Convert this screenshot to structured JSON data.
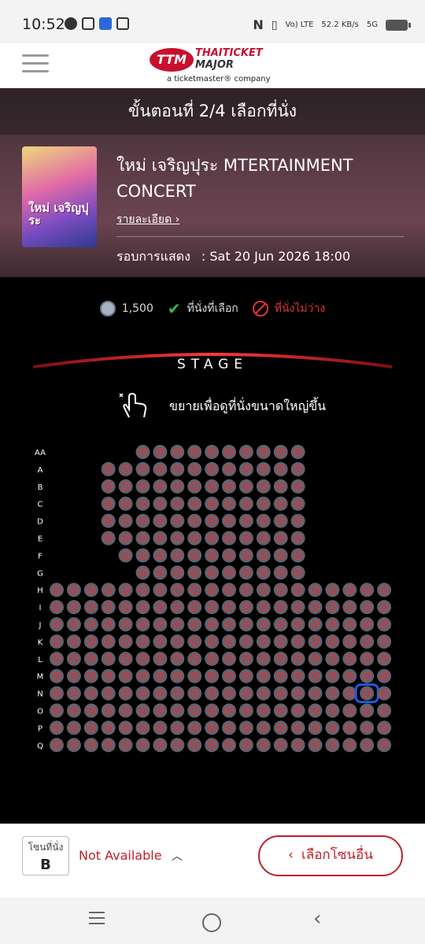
{
  "status_bar": {
    "time": "10:52",
    "network": "Vo) LTE",
    "speed": "52.2 KB/s",
    "signal": "5G"
  },
  "header": {
    "logo_badge": "TTM",
    "brand_line1": "THAITICKET",
    "brand_line2": "MAJOR",
    "tagline": "a ticketmaster® company"
  },
  "step": {
    "title": "ขั้นตอนที่ 2/4 เลือกที่นั่ง"
  },
  "event": {
    "poster_text": "ใหม่ เจริญปุระ",
    "title": "ใหม่ เจริญปุระ MTERTAINMENT CONCERT",
    "detail_link": "รายละเอียด ›",
    "showtime_label": "รอบการแสดง",
    "showtime_value": ": Sat 20 Jun 2026 18:00"
  },
  "legend": {
    "price": "1,500",
    "selected": "ที่นั่งที่เลือก",
    "unavailable": "ที่นั่งไม่ว่าง"
  },
  "stage": {
    "label": "STAGE"
  },
  "zoom_hint": "ขยายเพื่อดูที่นั่งขนาดใหญ่ขึ้น",
  "seatmap": {
    "rows": [
      "AA",
      "A",
      "B",
      "C",
      "D",
      "E",
      "F",
      "G",
      "H",
      "I",
      "J",
      "K",
      "L",
      "M",
      "N",
      "O",
      "P",
      "Q"
    ],
    "highlighted": {
      "row": "N",
      "seat_index": 18
    }
  },
  "bottom": {
    "zone_label": "โซนที่นั่ง",
    "zone_value": "B",
    "availability": "Not Available",
    "other_zone_button": "เลือกโซนอื่น"
  },
  "colors": {
    "accent": "#c0202a",
    "seat_fill": "#5c6470",
    "unavailable": "#e0343c",
    "selected_outline": "#1e5ae0"
  }
}
